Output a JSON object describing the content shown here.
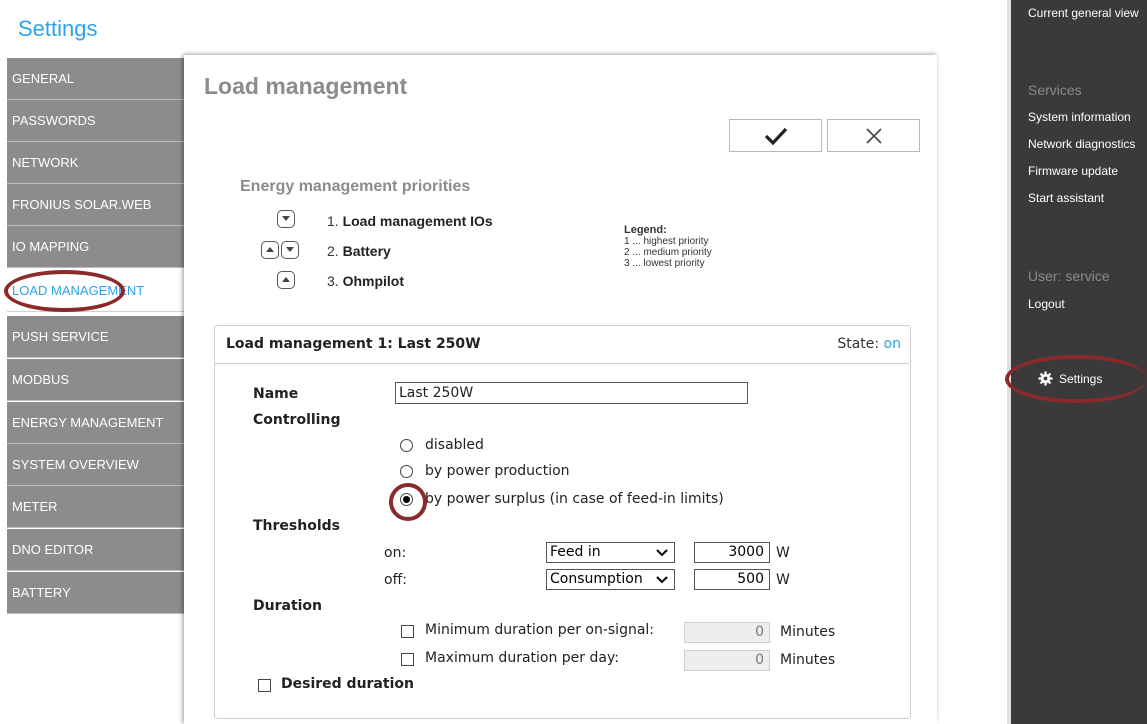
{
  "app": {
    "title": "Settings"
  },
  "nav": {
    "items": [
      {
        "label": "GENERAL"
      },
      {
        "label": "PASSWORDS"
      },
      {
        "label": "NETWORK"
      },
      {
        "label": "FRONIUS SOLAR.WEB"
      },
      {
        "label": "IO MAPPING"
      },
      {
        "label": "LOAD MANAGEMENT"
      },
      {
        "label": "PUSH SERVICE"
      },
      {
        "label": "MODBUS"
      },
      {
        "label": "ENERGY MANAGEMENT"
      },
      {
        "label": "SYSTEM OVERVIEW"
      },
      {
        "label": "METER"
      },
      {
        "label": "DNO EDITOR"
      },
      {
        "label": "BATTERY"
      }
    ],
    "active": "LOAD MANAGEMENT"
  },
  "main": {
    "title": "Load management",
    "confirm_icon": "check-icon",
    "cancel_icon": "close-icon",
    "priorities": {
      "title": "Energy management priorities",
      "items": [
        {
          "num": "1.",
          "label": "Load management IOs"
        },
        {
          "num": "2.",
          "label": "Battery"
        },
        {
          "num": "3.",
          "label": "Ohmpilot"
        }
      ],
      "legend": {
        "title": "Legend:",
        "lines": [
          "1 ... highest priority",
          "2 ... medium priority",
          "3 ... lowest priority"
        ]
      }
    },
    "load_mgmt": {
      "header": "Load management 1: Last 250W",
      "state_label": "State:",
      "state_value": "on",
      "name_label": "Name",
      "name_value": "Last 250W",
      "controlling_label": "Controlling",
      "options": [
        "disabled",
        "by power production",
        "by power surplus (in case of feed-in limits)"
      ],
      "selected_option": "by power surplus (in case of feed-in limits)",
      "thresholds_label": "Thresholds",
      "on_label": "on:",
      "on_select": "Feed in",
      "on_value": "3000",
      "off_label": "off:",
      "off_select": "Consumption",
      "off_value": "500",
      "unit_w": "W",
      "duration_label": "Duration",
      "min_duration_label": "Minimum duration per on-signal:",
      "min_duration_value": "0",
      "max_duration_label": "Maximum duration per day:",
      "max_duration_value": "0",
      "minutes": "Minutes",
      "desired_duration_label": "Desired duration"
    }
  },
  "right_panel": {
    "current_view": "Current general view",
    "services_title": "Services",
    "services": [
      "System information",
      "Network diagnostics",
      "Firmware update",
      "Start assistant"
    ],
    "user": "User: service",
    "logout": "Logout",
    "settings": "Settings"
  },
  "colors": {
    "accent": "#2aa4e8",
    "nav_bg": "#8c8c8c",
    "highlight_ring": "#8b2a2a",
    "right_panel_bg": "#3a3a3a"
  }
}
